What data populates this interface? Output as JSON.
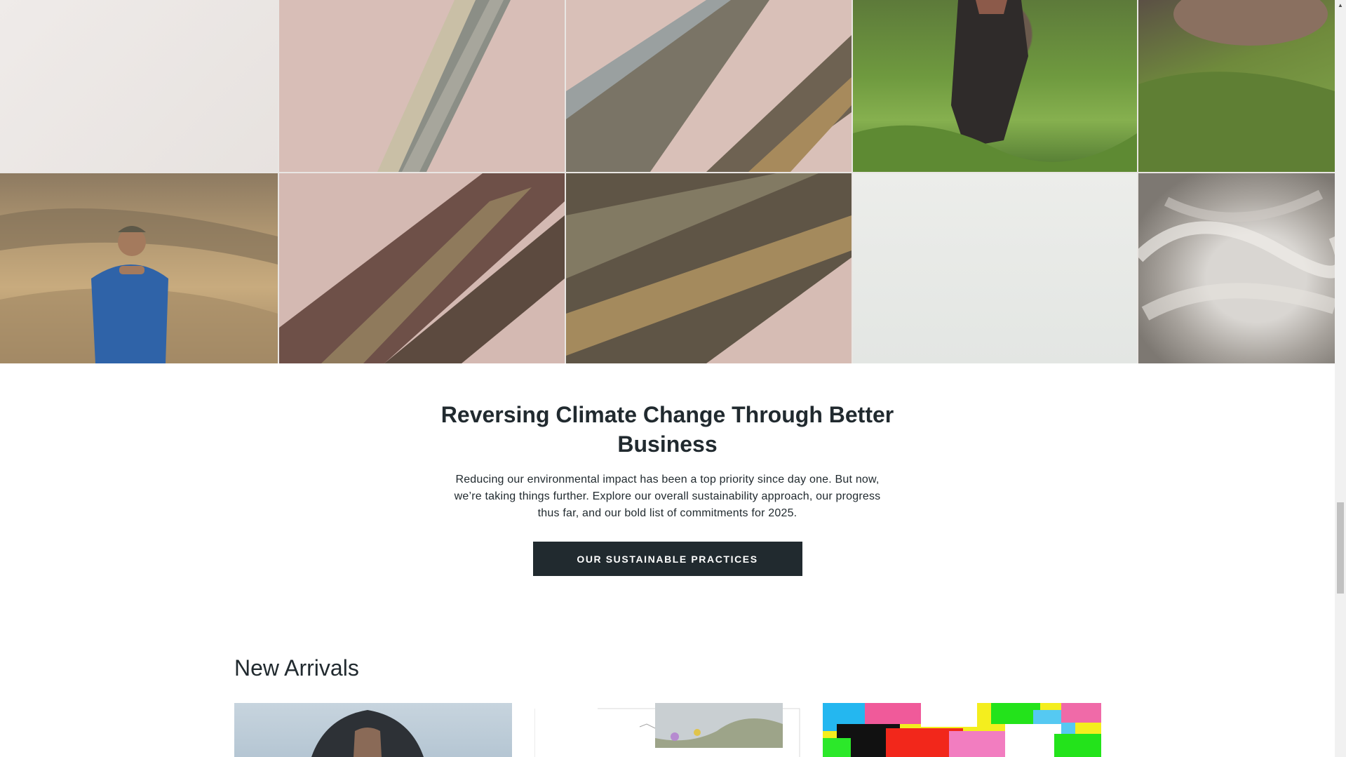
{
  "mission": {
    "title": "Reversing Climate Change Through Better Business",
    "body": "Reducing our environmental impact has been a top priority since day one. But now, we’re taking things further. Explore our overall sustainability approach, our progress thus far, and our bold list of commitments for 2025.",
    "cta_label": "OUR SUSTAINABLE PRACTICES"
  },
  "arrivals": {
    "title": "New Arrivals"
  },
  "colors": {
    "ink": "#212a2f",
    "cta_background": "#212a2f",
    "cta_text": "#ffffff",
    "grid_pink": "#d8beb7"
  },
  "icons": {
    "scroll_up": "scroll-up-arrow-icon"
  }
}
